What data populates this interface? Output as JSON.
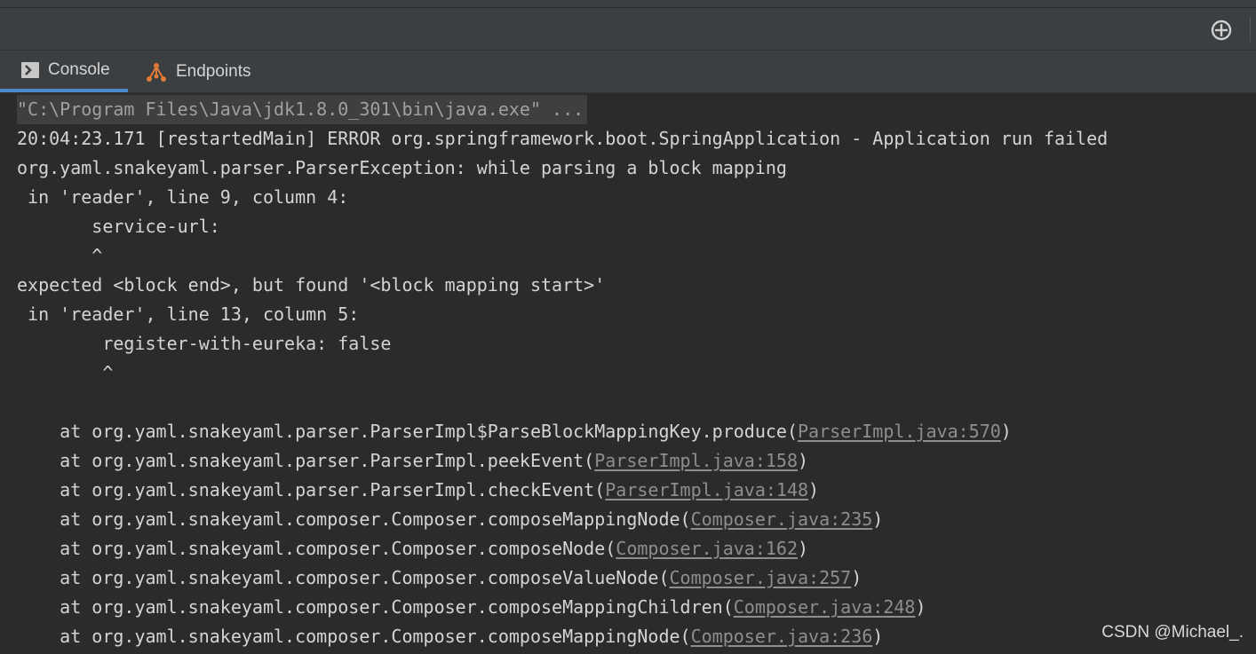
{
  "tabs": [
    {
      "label": "Console",
      "icon": "console-icon",
      "active": true
    },
    {
      "label": "Endpoints",
      "icon": "endpoints-icon",
      "active": false
    }
  ],
  "toolbar": {
    "target_icon": "crosshair-icon"
  },
  "console": {
    "command": "\"C:\\Program Files\\Java\\jdk1.8.0_301\\bin\\java.exe\" ...",
    "messages": [
      "20:04:23.171 [restartedMain] ERROR org.springframework.boot.SpringApplication - Application run failed",
      "org.yaml.snakeyaml.parser.ParserException: while parsing a block mapping",
      " in 'reader', line 9, column 4:",
      "       service-url:",
      "       ^",
      "expected <block end>, but found '<block mapping start>'",
      " in 'reader', line 13, column 5:",
      "        register-with-eureka: false",
      "        ^"
    ],
    "stack": [
      {
        "prefix": "    at org.yaml.snakeyaml.parser.ParserImpl$ParseBlockMappingKey.produce(",
        "link": "ParserImpl.java:570",
        "suffix": ")"
      },
      {
        "prefix": "    at org.yaml.snakeyaml.parser.ParserImpl.peekEvent(",
        "link": "ParserImpl.java:158",
        "suffix": ")"
      },
      {
        "prefix": "    at org.yaml.snakeyaml.parser.ParserImpl.checkEvent(",
        "link": "ParserImpl.java:148",
        "suffix": ")"
      },
      {
        "prefix": "    at org.yaml.snakeyaml.composer.Composer.composeMappingNode(",
        "link": "Composer.java:235",
        "suffix": ")"
      },
      {
        "prefix": "    at org.yaml.snakeyaml.composer.Composer.composeNode(",
        "link": "Composer.java:162",
        "suffix": ")"
      },
      {
        "prefix": "    at org.yaml.snakeyaml.composer.Composer.composeValueNode(",
        "link": "Composer.java:257",
        "suffix": ")"
      },
      {
        "prefix": "    at org.yaml.snakeyaml.composer.Composer.composeMappingChildren(",
        "link": "Composer.java:248",
        "suffix": ")"
      },
      {
        "prefix": "    at org.yaml.snakeyaml.composer.Composer.composeMappingNode(",
        "link": "Composer.java:236",
        "suffix": ")"
      }
    ]
  },
  "watermark": "CSDN @Michael_.",
  "colors": {
    "background": "#2b2b2b",
    "panel": "#3c3f41",
    "text": "#d4d4d4",
    "link": "#8e8e8e",
    "tab_underline": "#4a88c7",
    "endpoints_icon": "#e07b39"
  }
}
